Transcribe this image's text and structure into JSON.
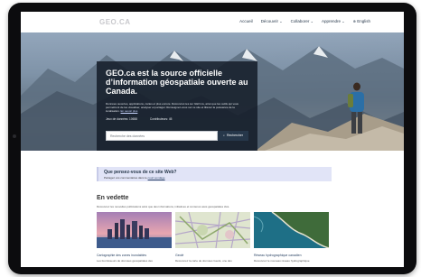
{
  "header": {
    "logo": "GEO.CA",
    "nav": [
      {
        "label": "Accueil",
        "dropdown": false
      },
      {
        "label": "Découvrir",
        "dropdown": true
      },
      {
        "label": "Collaborer",
        "dropdown": true
      },
      {
        "label": "Apprendre",
        "dropdown": true
      },
      {
        "label": "English",
        "dropdown": false,
        "icon": "globe-icon"
      }
    ]
  },
  "hero": {
    "title": "GEO.ca est la source officielle d’information géospatiale ouverte au Canada.",
    "lead": "Données ouvertes, applications, cartes et plus encore. Découvrez-les sur GEO.ca, ainsi que les outils qui vous permettront de les visualiser, analyser et partager. Renseignez-vous sur ce site et libérez la puissance de la localisation.",
    "lead_link": "En savoir plus",
    "stats": [
      "Jeux de données: 10658",
      "Contributeurs: 45"
    ],
    "search_placeholder": "Recherche des données",
    "search_button": "Rechercher"
  },
  "survey": {
    "title": "Que pensez-vous de ce site Web?",
    "text": "Partagez vos commentaires dans le",
    "link": "court sondage"
  },
  "featured": {
    "heading": "En vedette",
    "description": "Découvrez les nouvelles publications ainsi que des informations, initiatives et contenus axés géospatiales clés.",
    "cards": [
      {
        "title": "Cartographie des zones inondables",
        "desc": "Les fournisseurs de données géospatiales des"
      },
      {
        "title": "Geolé",
        "desc": "Découvrez la carte de données Geolé, une des"
      },
      {
        "title": "Réseau hydrographique canadien",
        "desc": "Découvrez le nouveau réseau hydrographique"
      }
    ]
  }
}
